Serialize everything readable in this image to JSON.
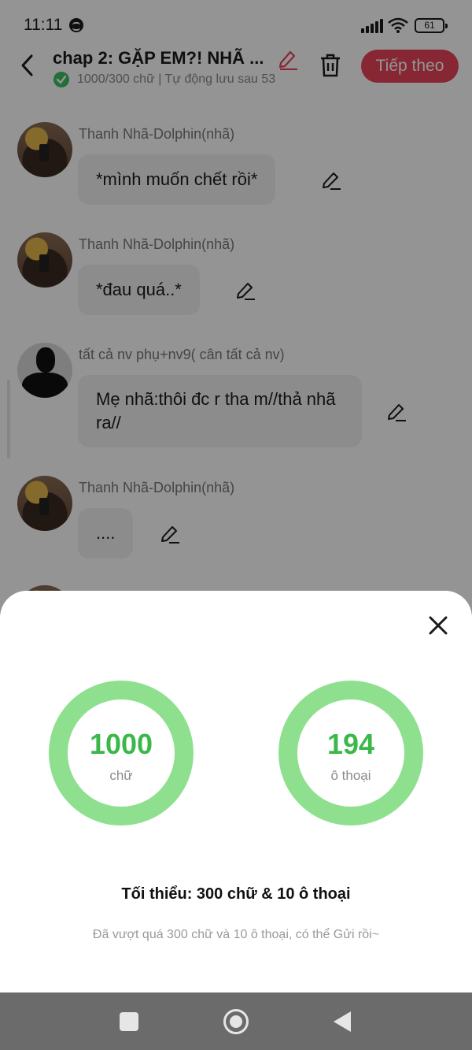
{
  "status_bar": {
    "time": "11:11",
    "battery": "61"
  },
  "header": {
    "chapter_title": "chap 2: GẶP EM?! NHÃ ...",
    "save_status": "1000/300 chữ | Tự động lưu sau 53",
    "next_label": "Tiếp theo"
  },
  "messages": [
    {
      "speaker": "Thanh Nhã-Dolphin(nhã)",
      "text": "*mình muốn chết rồi*",
      "avatar": "photo"
    },
    {
      "speaker": "Thanh Nhã-Dolphin(nhã)",
      "text": "*đau quá..*",
      "avatar": "photo"
    },
    {
      "speaker": "tất cả nv phụ+nv9( cân tất cả nv)",
      "text": "Mẹ nhã:thôi đc r tha m//thả nhã ra//",
      "avatar": "silhouette"
    },
    {
      "speaker": "Thanh Nhã-Dolphin(nhã)",
      "text": "....",
      "avatar": "photo"
    }
  ],
  "sheet": {
    "words_value": "1000",
    "words_label": "chữ",
    "dialog_value": "194",
    "dialog_label": "ô thoại",
    "minimum": "Tối thiểu: 300 chữ & 10 ô thoại",
    "note": "Đã vượt quá 300 chữ và 10 ô thoại, có thể Gửi rồi~"
  },
  "colors": {
    "accent": "#e8445a",
    "ring": "#8ee08f",
    "ring_value": "#3bb84a"
  }
}
